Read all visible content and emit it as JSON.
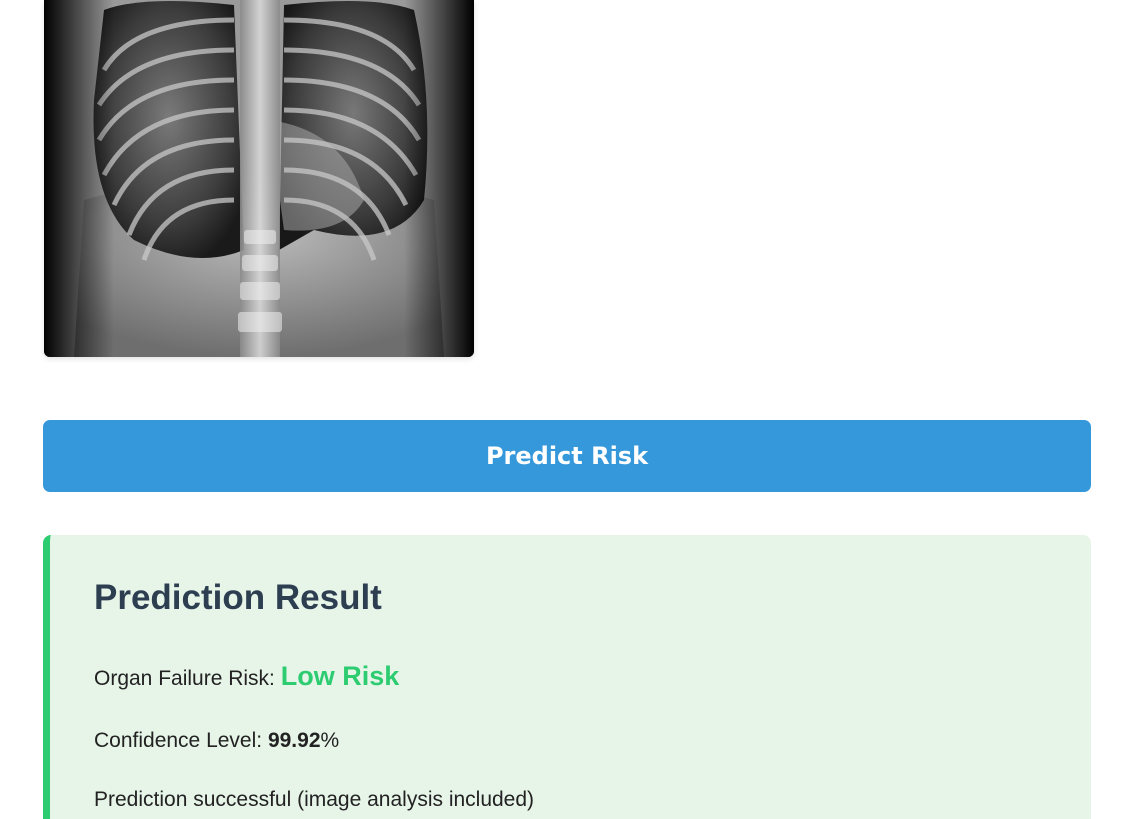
{
  "theme": {
    "accent": "#3598db",
    "success": "#2ecc71",
    "result_bg": "#e7f5e9",
    "heading": "#2c3e50"
  },
  "image": {
    "icon": "chest-xray-image"
  },
  "actions": {
    "predict_label": "Predict Risk"
  },
  "result": {
    "title": "Prediction Result",
    "risk_label": "Organ Failure Risk: ",
    "risk_value": "Low Risk",
    "confidence_label": "Confidence Level: ",
    "confidence_value": "99.92",
    "confidence_unit": "%",
    "status_message": "Prediction successful (image analysis included)"
  }
}
